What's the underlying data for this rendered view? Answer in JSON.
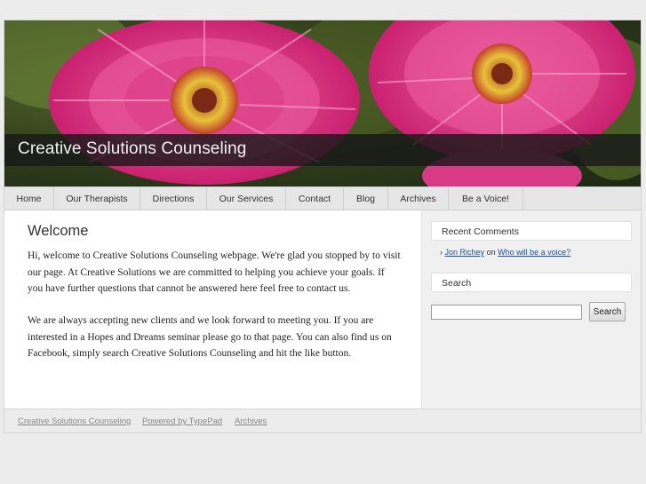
{
  "header": {
    "site_title": "Creative Solutions Counseling"
  },
  "nav": {
    "items": [
      {
        "label": "Home"
      },
      {
        "label": "Our Therapists"
      },
      {
        "label": "Directions"
      },
      {
        "label": "Our Services"
      },
      {
        "label": "Contact"
      },
      {
        "label": "Blog"
      },
      {
        "label": "Archives"
      },
      {
        "label": "Be a Voice!"
      }
    ]
  },
  "main": {
    "title": "Welcome",
    "paragraphs": [
      "Hi, welcome to Creative Solutions Counseling webpage. We're glad you stopped by to visit our page. At Creative Solutions we are committed to helping you achieve your goals. If you have further questions that cannot be answered here feel free to contact us.",
      "We are always accepting new clients and we look forward to meeting you. If you are interested in a Hopes and Dreams seminar please go to that page. You can also find us on Facebook, simply search Creative Solutions Counseling and hit the like button."
    ]
  },
  "sidebar": {
    "recent_comments": {
      "heading": "Recent Comments",
      "author": "Jon Richey",
      "connector": "on",
      "post": "Who will be a voice?"
    },
    "search": {
      "heading": "Search",
      "input_value": "",
      "button_label": "Search"
    }
  },
  "footer": {
    "links": [
      {
        "label": "Creative Solutions Counseling"
      },
      {
        "label": "Powered by TypePad"
      },
      {
        "label": "Archives"
      }
    ]
  },
  "colors": {
    "flower_pink": "#e0418a",
    "flower_center": "#e8c23a",
    "link": "#1a4f9c",
    "title_bar": "#1e1e1e"
  }
}
